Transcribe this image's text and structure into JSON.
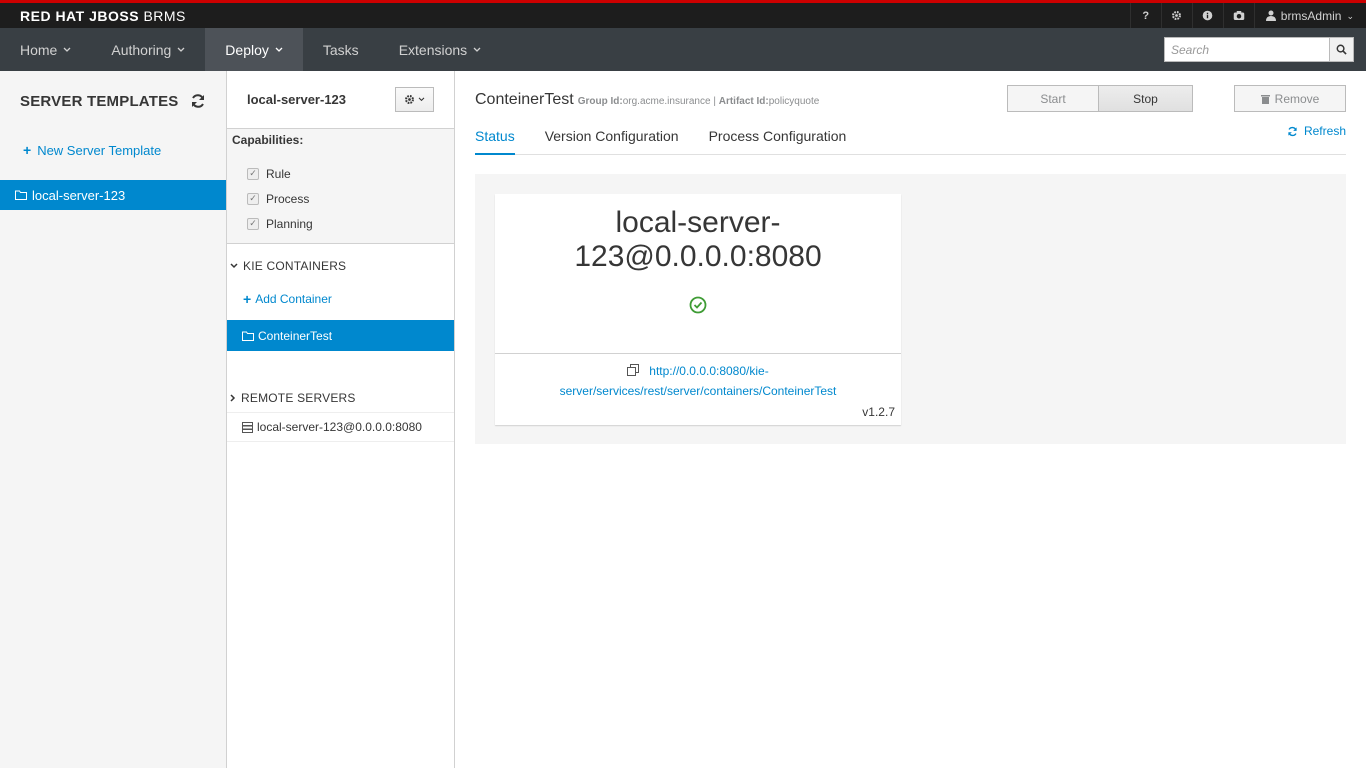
{
  "brand": {
    "part1": "RED HAT",
    "part2": "JBOSS",
    "part3": "BRMS"
  },
  "topbar": {
    "help": "?",
    "user": "brmsAdmin"
  },
  "nav": {
    "items": [
      {
        "label": "Home",
        "dropdown": true
      },
      {
        "label": "Authoring",
        "dropdown": true
      },
      {
        "label": "Deploy",
        "dropdown": true,
        "active": true
      },
      {
        "label": "Tasks",
        "dropdown": false
      },
      {
        "label": "Extensions",
        "dropdown": true
      }
    ],
    "search_placeholder": "Search"
  },
  "templates": {
    "title": "SERVER TEMPLATES",
    "new_label": "New Server Template",
    "selected": "local-server-123"
  },
  "server": {
    "name": "local-server-123",
    "capabilities_title": "Capabilities:",
    "capabilities": [
      "Rule",
      "Process",
      "Planning"
    ],
    "kie_title": "KIE CONTAINERS",
    "add_container": "Add Container",
    "container": "ConteinerTest",
    "remote_title": "REMOTE SERVERS",
    "remote": "local-server-123@0.0.0.0:8080"
  },
  "container": {
    "name": "ConteinerTest",
    "group_label": "Group Id:",
    "group_value": "org.acme.insurance",
    "separator": "|",
    "artifact_label": "Artifact Id:",
    "artifact_value": "policyquote",
    "start": "Start",
    "stop": "Stop",
    "remove": "Remove",
    "tabs": [
      "Status",
      "Version Configuration",
      "Process Configuration"
    ],
    "refresh": "Refresh"
  },
  "card": {
    "line1": "local-server-",
    "line2": "123@0.0.0.0:8080",
    "url_line1": "http://0.0.0.0:8080/kie-",
    "url_line2": "server/services/rest/server/containers/ConteinerTest",
    "version": "v1.2.7"
  },
  "colors": {
    "accent": "#0088ce",
    "nav": "#393f44",
    "topbar": "#1d1d1d",
    "ok": "#3f9c35"
  }
}
